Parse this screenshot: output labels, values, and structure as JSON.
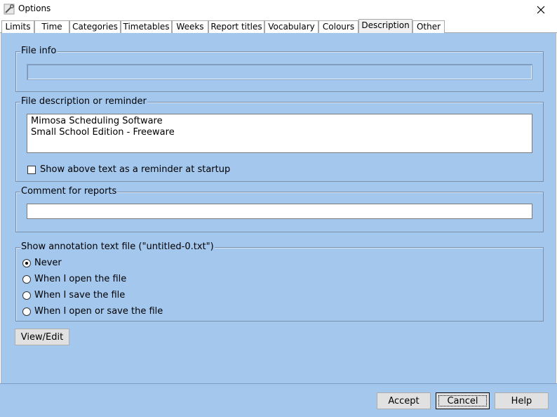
{
  "window": {
    "title": "Options",
    "icon": "wrench-icon"
  },
  "tabs": [
    {
      "label": "Limits"
    },
    {
      "label": "Time"
    },
    {
      "label": "Categories"
    },
    {
      "label": "Timetables"
    },
    {
      "label": "Weeks"
    },
    {
      "label": "Report titles"
    },
    {
      "label": "Vocabulary"
    },
    {
      "label": "Colours"
    },
    {
      "label": "Description",
      "active": true
    },
    {
      "label": "Other"
    }
  ],
  "file_info": {
    "legend": "File info",
    "value": ""
  },
  "file_description": {
    "legend": "File description or reminder",
    "lines": [
      "Mimosa Scheduling Software",
      "Small School Edition - Freeware"
    ],
    "reminder_checkbox_label": "Show above text as a reminder at startup",
    "reminder_checked": false
  },
  "comment": {
    "legend": "Comment for reports",
    "value": ""
  },
  "annotation": {
    "legend": "Show annotation text file (\"untitled-0.txt\")",
    "options": [
      {
        "label": "Never",
        "checked": true
      },
      {
        "label": "When I open the file",
        "checked": false
      },
      {
        "label": "When I save the file",
        "checked": false
      },
      {
        "label": "When I open or save the file",
        "checked": false
      }
    ]
  },
  "view_edit_label": "View/Edit",
  "buttons": {
    "accept": "Accept",
    "cancel": "Cancel",
    "help": "Help"
  },
  "colors": {
    "panel": "#a4c7ee",
    "border": "#7c8fa8"
  }
}
